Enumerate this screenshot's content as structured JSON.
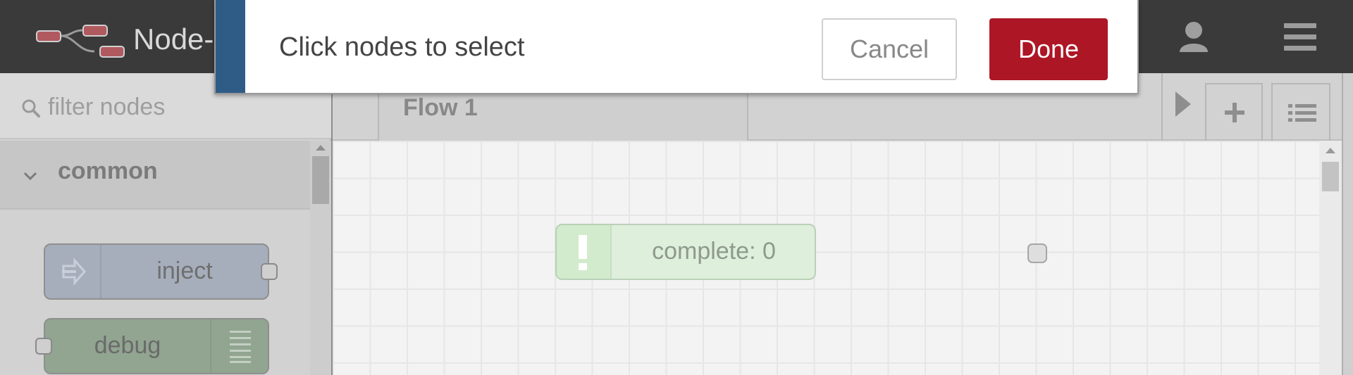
{
  "header": {
    "title": "Node-",
    "logo_icon": "node-red-logo-icon",
    "user_icon": "user-icon",
    "menu_icon": "hamburger-menu-icon"
  },
  "palette": {
    "search": {
      "placeholder": "filter nodes",
      "value": ""
    },
    "category": {
      "label": "common",
      "icon": "chevron-down-icon"
    },
    "nodes": [
      {
        "label": "inject",
        "color": "#a6aebc",
        "icon": "inject-arrow-icon"
      },
      {
        "label": "debug",
        "color": "#91a590",
        "icon": "debug-list-icon"
      }
    ]
  },
  "workspace": {
    "tabs": [
      {
        "label": "Flow 1"
      }
    ],
    "add_flow_icon": "plus-icon",
    "list_flows_icon": "list-icon",
    "scroll_right_icon": "caret-right-icon",
    "nodes": [
      {
        "label": "complete: 0",
        "color": "#deefdc",
        "icon": "exclamation-icon"
      }
    ]
  },
  "notification": {
    "message": "Click nodes to select",
    "cancel_label": "Cancel",
    "done_label": "Done",
    "accent_color": "#2f5c86",
    "done_color": "#ad1625"
  }
}
